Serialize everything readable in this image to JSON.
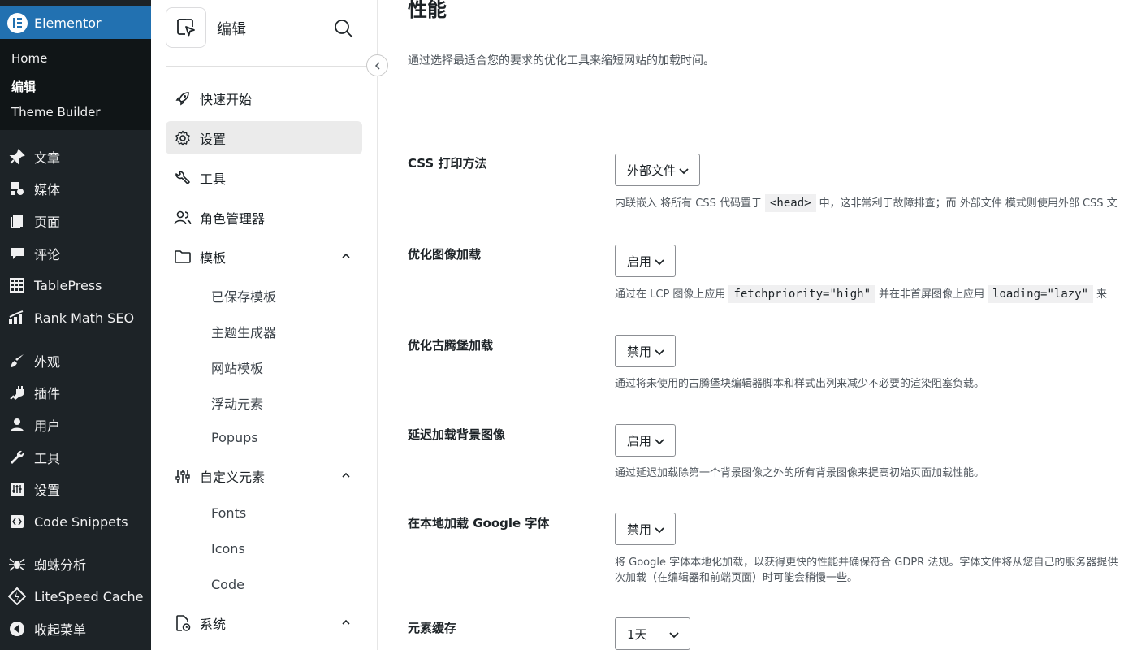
{
  "wp_menu": {
    "active": "Elementor",
    "submenu": [
      "Home",
      "编辑",
      "Theme Builder"
    ],
    "items": [
      {
        "label": "文章",
        "icon": "pin-icon"
      },
      {
        "label": "媒体",
        "icon": "media-icon"
      },
      {
        "label": "页面",
        "icon": "pages-icon"
      },
      {
        "label": "评论",
        "icon": "comment-icon"
      },
      {
        "label": "TablePress",
        "icon": "table-icon"
      },
      {
        "label": "Rank Math SEO",
        "icon": "chart-icon"
      },
      {
        "label": "外观",
        "icon": "brush-icon"
      },
      {
        "label": "插件",
        "icon": "plugin-icon"
      },
      {
        "label": "用户",
        "icon": "user-icon"
      },
      {
        "label": "工具",
        "icon": "wrench-icon"
      },
      {
        "label": "设置",
        "icon": "sliders-icon"
      },
      {
        "label": "Code Snippets",
        "icon": "code-icon"
      },
      {
        "label": "蜘蛛分析",
        "icon": "spider-icon"
      },
      {
        "label": "LiteSpeed Cache",
        "icon": "diamond-icon"
      },
      {
        "label": "收起菜单",
        "icon": "collapse-icon"
      }
    ]
  },
  "panel": {
    "title": "编辑",
    "nav": [
      {
        "label": "快速开始",
        "icon": "rocket-icon"
      },
      {
        "label": "设置",
        "icon": "gear-icon"
      },
      {
        "label": "工具",
        "icon": "wrench-icon"
      },
      {
        "label": "角色管理器",
        "icon": "users-icon"
      },
      {
        "label": "模板",
        "icon": "folder-icon"
      },
      {
        "label": "自定义元素",
        "icon": "sliders-icon"
      },
      {
        "label": "系统",
        "icon": "system-icon"
      }
    ],
    "templates_children": [
      "已保存模板",
      "主题生成器",
      "网站模板",
      "浮动元素",
      "Popups"
    ],
    "custom_children": [
      "Fonts",
      "Icons",
      "Code"
    ]
  },
  "main": {
    "title": "性能",
    "description": "通过选择最适合您的要求的优化工具来缩短网站的加载时间。",
    "settings": [
      {
        "label": "CSS 打印方法",
        "value": "外部文件",
        "help_parts": [
          "内联嵌入 将所有 CSS 代码置于",
          "<head>",
          "中，这非常利于故障排查；而 外部文件 模式则使用外部 CSS 文"
        ]
      },
      {
        "label": "优化图像加载",
        "value": "启用",
        "help_parts": [
          "通过在 LCP 图像上应用",
          "fetchpriority=\"high\"",
          "并在非首屏图像上应用",
          "loading=\"lazy\"",
          "来"
        ]
      },
      {
        "label": "优化古腾堡加载",
        "value": "禁用",
        "help": "通过将未使用的古腾堡块编辑器脚本和样式出列来减少不必要的渲染阻塞负载。"
      },
      {
        "label": "延迟加载背景图像",
        "value": "启用",
        "help": "通过延迟加载除第一个背景图像之外的所有背景图像来提高初始页面加载性能。"
      },
      {
        "label": "在本地加载 Google 字体",
        "value": "禁用",
        "help_lines": [
          "将 Google 字体本地化加载，以获得更快的性能并确保符合 GDPR 法规。字体文件将从您自己的服务器提供",
          "次加载（在编辑器和前端页面）时可能会稍慢一些。"
        ]
      },
      {
        "label": "元素缓存",
        "value": "1天"
      }
    ]
  },
  "colors": {
    "wp_sidebar": "#1d2327",
    "wp_active": "#2271b1",
    "panel_active_bg": "#ebebeb"
  }
}
